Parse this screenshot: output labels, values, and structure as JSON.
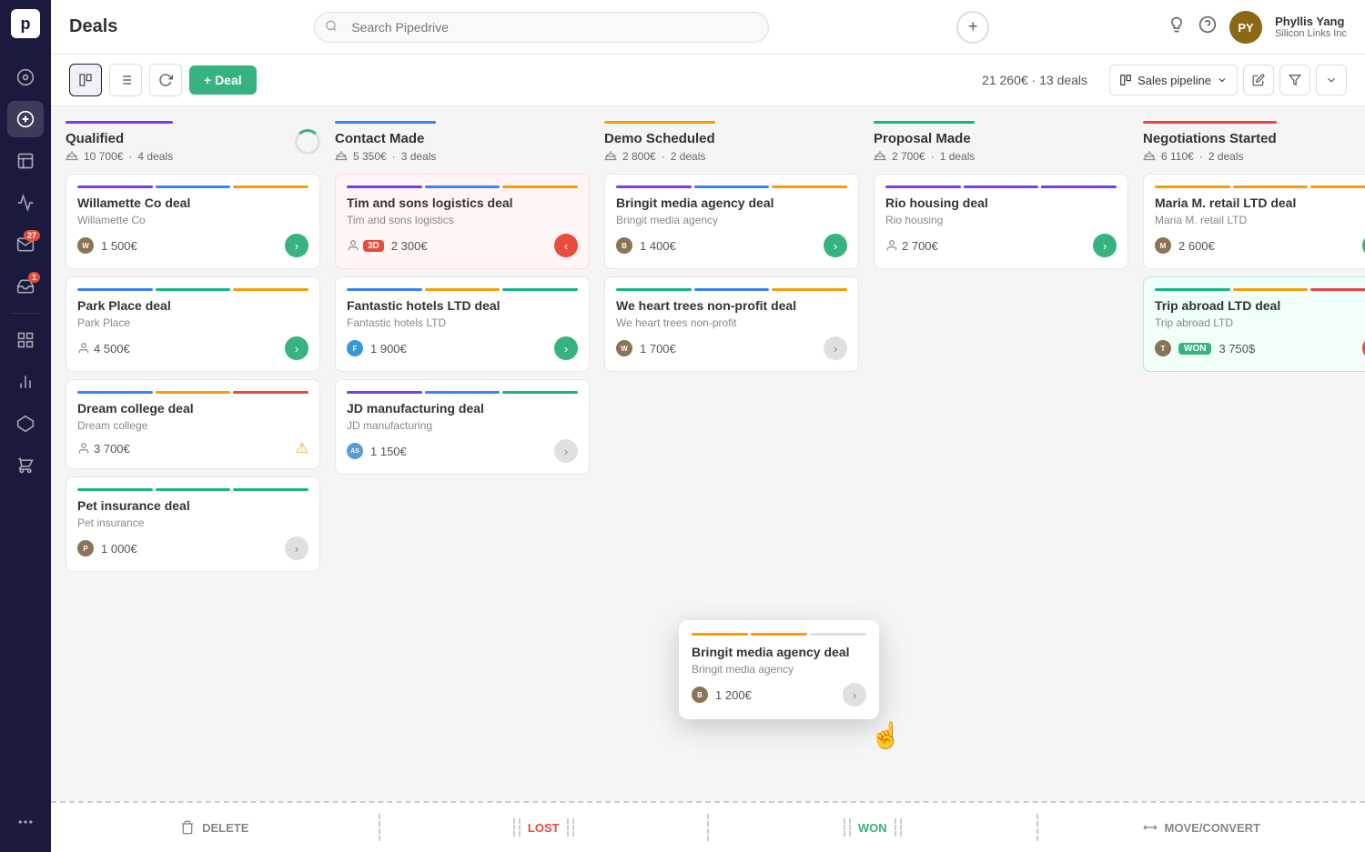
{
  "app": {
    "title": "Deals",
    "search_placeholder": "Search Pipedrive"
  },
  "user": {
    "name": "Phyllis Yang",
    "company": "Silicon Links Inc",
    "initials": "PY"
  },
  "toolbar": {
    "deal_count": "21 260€ · 13 deals",
    "pipeline_label": "Sales pipeline",
    "add_deal_label": "+ Deal"
  },
  "columns": [
    {
      "id": "qualified",
      "title": "Qualified",
      "amount": "10 700€",
      "deal_count": "4 deals",
      "strip_color": "#7c3aed",
      "cards": [
        {
          "id": "c1",
          "title": "Willamette Co deal",
          "company": "Willamette Co",
          "amount": "1 500€",
          "arrow": "green",
          "colors": [
            "#7c3aed",
            "#3b82f6",
            "#f59e0b"
          ],
          "avatar": "brown",
          "avatar_initials": "W"
        },
        {
          "id": "c2",
          "title": "Park Place deal",
          "company": "Park Place",
          "amount": "4 500€",
          "arrow": "green",
          "colors": [
            "#3b82f6",
            "#10b981",
            "#f59e0b"
          ],
          "person_icon": true
        },
        {
          "id": "c3",
          "title": "Dream college deal",
          "company": "Dream college",
          "amount": "3 700€",
          "arrow": "warning",
          "colors": [
            "#3b82f6",
            "#f59e0b",
            "#ef4444"
          ],
          "person_icon": true
        },
        {
          "id": "c4",
          "title": "Pet insurance deal",
          "company": "Pet insurance",
          "amount": "1 000€",
          "arrow": "gray",
          "colors": [
            "#10b981",
            "#10b981",
            "#10b981"
          ],
          "avatar": "brown",
          "avatar_initials": "P"
        }
      ]
    },
    {
      "id": "contact_made",
      "title": "Contact Made",
      "amount": "5 350€",
      "deal_count": "3 deals",
      "strip_color": "#3b82f6",
      "cards": [
        {
          "id": "c5",
          "title": "Tim and sons logistics deal",
          "company": "Tim and sons logistics",
          "amount": "2 300€",
          "arrow": "red",
          "colors": [
            "#7c3aed",
            "#3b82f6",
            "#f59e0b"
          ],
          "badge_3d": true,
          "person_icon": true
        },
        {
          "id": "c6",
          "title": "Fantastic hotels LTD deal",
          "company": "Fantastic hotels LTD",
          "amount": "1 900€",
          "arrow": "green",
          "colors": [
            "#3b82f6",
            "#f59e0b",
            "#10b981"
          ],
          "avatar": "blue",
          "avatar_initials": "F"
        },
        {
          "id": "c7",
          "title": "JD manufacturing deal",
          "company": "JD manufacturing",
          "amount": "1 150€",
          "arrow": "gray",
          "colors": [
            "#7c3aed",
            "#3b82f6",
            "#10b981"
          ],
          "avatar": "teal",
          "avatar_initials": "AS"
        }
      ]
    },
    {
      "id": "demo_scheduled",
      "title": "Demo Scheduled",
      "amount": "2 800€",
      "deal_count": "2 deals",
      "strip_color": "#f59e0b",
      "cards": [
        {
          "id": "c8",
          "title": "Bringit media agency deal",
          "company": "Bringit media agency",
          "amount": "1 400€",
          "arrow": "green",
          "colors": [
            "#7c3aed",
            "#3b82f6",
            "#f59e0b"
          ],
          "avatar": "brown",
          "avatar_initials": "B"
        },
        {
          "id": "c9",
          "title": "We heart trees non-profit deal",
          "company": "We heart trees non-profit",
          "amount": "1 700€",
          "arrow": "gray",
          "colors": [
            "#10b981",
            "#3b82f6",
            "#f59e0b"
          ],
          "avatar": "brown",
          "avatar_initials": "W"
        }
      ]
    },
    {
      "id": "proposal_made",
      "title": "Proposal Made",
      "amount": "2 700€",
      "deal_count": "1 deals",
      "strip_color": "#10b981",
      "cards": [
        {
          "id": "c10",
          "title": "Rio housing deal",
          "company": "Rio housing",
          "amount": "2 700€",
          "arrow": "green",
          "colors": [
            "#7c3aed",
            "#7c3aed",
            "#7c3aed"
          ],
          "person_icon": true
        }
      ]
    },
    {
      "id": "negotiations_started",
      "title": "Negotiations Started",
      "amount": "6 110€",
      "deal_count": "2 deals",
      "strip_color": "#ef4444",
      "cards": [
        {
          "id": "c11",
          "title": "Maria M. retail LTD deal",
          "company": "Maria M. retail LTD",
          "amount": "2 600€",
          "arrow": "green",
          "colors": [
            "#f59e0b",
            "#f59e0b",
            "#f59e0b"
          ],
          "avatar": "brown",
          "avatar_initials": "M"
        },
        {
          "id": "c12",
          "title": "Trip abroad LTD deal",
          "company": "Trip abroad LTD",
          "amount": "3 750$",
          "arrow": "red",
          "colors": [
            "#10b981",
            "#f59e0b",
            "#ef4444"
          ],
          "won_badge": true,
          "avatar": "brown",
          "avatar_initials": "T",
          "highlighted": true
        }
      ]
    }
  ],
  "floating_card": {
    "title": "Bringit media agency deal",
    "company": "Bringit media agency",
    "amount": "1 200€",
    "avatar_initials": "B"
  },
  "bottom_zones": [
    {
      "label": "DELETE",
      "color": "default"
    },
    {
      "label": "LOST",
      "color": "lost"
    },
    {
      "label": "WON",
      "color": "won"
    },
    {
      "label": "MOVE/CONVERT",
      "color": "default"
    }
  ],
  "sidebar": {
    "logo": "p",
    "items": [
      {
        "icon": "⊙",
        "name": "activity"
      },
      {
        "icon": "$",
        "name": "deals",
        "active": true
      },
      {
        "icon": "☰",
        "name": "list"
      },
      {
        "icon": "📢",
        "name": "campaigns"
      },
      {
        "icon": "✉",
        "name": "mail",
        "badge": "27"
      },
      {
        "icon": "📬",
        "name": "inbox",
        "badge": "1"
      },
      {
        "icon": "▤",
        "name": "reports"
      },
      {
        "icon": "📊",
        "name": "analytics"
      },
      {
        "icon": "⬡",
        "name": "integrations"
      },
      {
        "icon": "🏪",
        "name": "marketplace"
      },
      {
        "icon": "...",
        "name": "more"
      }
    ]
  }
}
